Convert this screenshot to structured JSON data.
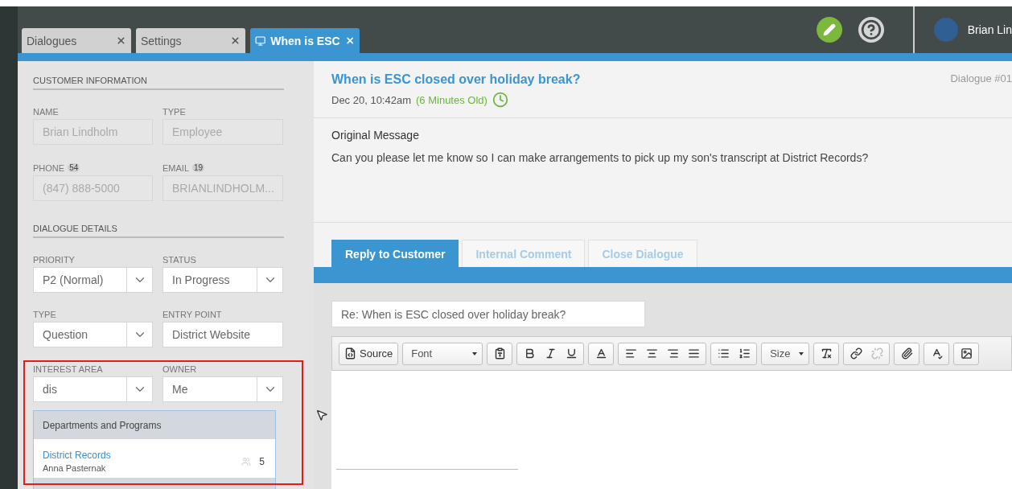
{
  "tabs": [
    {
      "label": "Dialogues",
      "selected": false,
      "closable": true
    },
    {
      "label": "Settings",
      "selected": false,
      "closable": true
    },
    {
      "label": "When is ESC",
      "selected": true,
      "closable": true
    }
  ],
  "user": {
    "name": "Brian Lin"
  },
  "customer": {
    "heading": "CUSTOMER INFORMATION",
    "fields": [
      {
        "label": "NAME",
        "value": "Brian Lindholm"
      },
      {
        "label": "TYPE",
        "value": "Employee"
      },
      {
        "label": "PHONE",
        "count": "54",
        "value": "(847) 888-5000"
      },
      {
        "label": "EMAIL",
        "count": "19",
        "value": "BRIANLINDHOLM..."
      }
    ]
  },
  "details": {
    "heading": "DIALOGUE DETAILS",
    "fields": [
      {
        "label": "PRIORITY",
        "value": "P2 (Normal)",
        "kind": "select"
      },
      {
        "label": "STATUS",
        "value": "In Progress",
        "kind": "select"
      },
      {
        "label": "TYPE",
        "value": "Question",
        "kind": "select"
      },
      {
        "label": "ENTRY POINT",
        "value": "District Website",
        "kind": "text"
      },
      {
        "label": "INTEREST AREA",
        "value": "dis",
        "kind": "select"
      },
      {
        "label": "OWNER",
        "value": "Me",
        "kind": "select"
      }
    ]
  },
  "dropdown": {
    "group": "Departments and Programs",
    "options": [
      {
        "name": "District Records",
        "owner": "Anna Pasternak",
        "count": "5"
      }
    ]
  },
  "dialogue": {
    "title": "When is ESC closed over holiday break?",
    "date": "Dec 20, 10:42am",
    "age": "(6 Minutes Old)",
    "number": "Dialogue #01"
  },
  "message": {
    "heading": "Original Message",
    "body": "Can you please let me know so I can make arrangements to pick up my son's transcript at District Records?"
  },
  "reply_tabs": [
    {
      "label": "Reply to Customer",
      "selected": true
    },
    {
      "label": "Internal Comment",
      "selected": false
    },
    {
      "label": "Close Dialogue",
      "selected": false
    }
  ],
  "subject": {
    "value": "Re: When is ESC closed over holiday break?"
  },
  "toolbar": [
    [
      {
        "kind": "source",
        "label": "Source",
        "disabled": false
      }
    ],
    [
      {
        "kind": "combo",
        "label": "Font"
      }
    ],
    [
      {
        "kind": "paste",
        "disabled": false
      }
    ],
    [
      {
        "kind": "bold",
        "disabled": false
      },
      {
        "kind": "italic",
        "disabled": false
      },
      {
        "kind": "underline",
        "disabled": false
      }
    ],
    [
      {
        "kind": "color",
        "disabled": false
      }
    ],
    [
      {
        "kind": "align-left",
        "disabled": false
      },
      {
        "kind": "align-center",
        "disabled": false
      },
      {
        "kind": "align-right",
        "disabled": false
      },
      {
        "kind": "justify",
        "disabled": false
      }
    ],
    [
      {
        "kind": "bullets",
        "disabled": false
      },
      {
        "kind": "numbers",
        "disabled": false
      }
    ],
    [
      {
        "kind": "combo",
        "label": "Size"
      }
    ],
    [
      {
        "kind": "clear-format",
        "disabled": false
      }
    ],
    [
      {
        "kind": "link",
        "disabled": false
      },
      {
        "kind": "unlink",
        "disabled": true
      }
    ],
    [
      {
        "kind": "attach",
        "disabled": false
      }
    ],
    [
      {
        "kind": "spellcheck",
        "disabled": false
      }
    ],
    [
      {
        "kind": "image",
        "disabled": false
      }
    ]
  ]
}
